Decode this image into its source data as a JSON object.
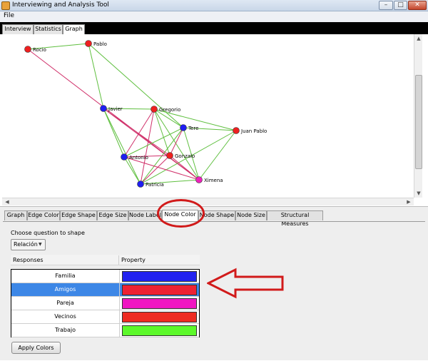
{
  "window": {
    "title": "Interviewing and Analysis Tool",
    "min_glyph": "–",
    "max_glyph": "□",
    "close_glyph": "✕"
  },
  "menu": {
    "file": "File"
  },
  "top_tabs": [
    {
      "label": "Interview",
      "active": false
    },
    {
      "label": "Statistics",
      "active": false
    },
    {
      "label": "Graph",
      "active": true
    }
  ],
  "graph": {
    "colors": {
      "blue": "#1f1ff0",
      "red": "#ee2020",
      "magenta": "#ee22bb",
      "edge_green": "#5fbf3f",
      "edge_pink": "#d0306a"
    },
    "nodes": [
      {
        "id": "rocio",
        "label": "Rocio",
        "color": "red"
      },
      {
        "id": "pablo",
        "label": "Pablo",
        "color": "red"
      },
      {
        "id": "javier",
        "label": "Javier",
        "color": "blue"
      },
      {
        "id": "gregorio",
        "label": "Gregorio",
        "color": "red"
      },
      {
        "id": "tere",
        "label": "Tere",
        "color": "blue"
      },
      {
        "id": "juanpablo",
        "label": "Juan Pablo",
        "color": "red"
      },
      {
        "id": "antonio",
        "label": "Antonio",
        "color": "blue"
      },
      {
        "id": "gonzalo",
        "label": "Gonzalo",
        "color": "red"
      },
      {
        "id": "ximena",
        "label": "Ximena",
        "color": "magenta"
      },
      {
        "id": "patricia",
        "label": "Patricia",
        "color": "blue"
      }
    ],
    "edges": [
      [
        "rocio",
        "pablo",
        "green"
      ],
      [
        "rocio",
        "ximena",
        "pink"
      ],
      [
        "pablo",
        "javier",
        "green"
      ],
      [
        "pablo",
        "tere",
        "green"
      ],
      [
        "javier",
        "gregorio",
        "green"
      ],
      [
        "javier",
        "antonio",
        "green"
      ],
      [
        "javier",
        "patricia",
        "green"
      ],
      [
        "javier",
        "ximena",
        "pink"
      ],
      [
        "javier",
        "gonzalo",
        "pink"
      ],
      [
        "gregorio",
        "juanpablo",
        "green"
      ],
      [
        "gregorio",
        "antonio",
        "pink"
      ],
      [
        "gregorio",
        "patricia",
        "pink"
      ],
      [
        "gregorio",
        "gonzalo",
        "green"
      ],
      [
        "gregorio",
        "ximena",
        "green"
      ],
      [
        "gregorio",
        "tere",
        "green"
      ],
      [
        "tere",
        "juanpablo",
        "green"
      ],
      [
        "tere",
        "antonio",
        "green"
      ],
      [
        "tere",
        "patricia",
        "green"
      ],
      [
        "tere",
        "gonzalo",
        "pink"
      ],
      [
        "tere",
        "ximena",
        "green"
      ],
      [
        "juanpablo",
        "ximena",
        "green"
      ],
      [
        "juanpablo",
        "patricia",
        "green"
      ],
      [
        "antonio",
        "gonzalo",
        "pink"
      ],
      [
        "antonio",
        "patricia",
        "green"
      ],
      [
        "antonio",
        "ximena",
        "pink"
      ],
      [
        "gonzalo",
        "patricia",
        "pink"
      ],
      [
        "gonzalo",
        "ximena",
        "pink"
      ],
      [
        "patricia",
        "ximena",
        "green"
      ]
    ]
  },
  "sub_tabs": [
    {
      "label": "Graph",
      "active": false
    },
    {
      "label": "Edge Color",
      "active": false
    },
    {
      "label": "Edge Shape",
      "active": false
    },
    {
      "label": "Edge Size",
      "active": false
    },
    {
      "label": "Node Label",
      "active": false
    },
    {
      "label": "Node Color",
      "active": true
    },
    {
      "label": "Node Shape",
      "active": false
    },
    {
      "label": "Node Size",
      "active": false
    },
    {
      "label": "Structural Measures",
      "active": false
    }
  ],
  "node_color_panel": {
    "choose_label": "Choose question to shape",
    "selected_question": "Relación",
    "columns": {
      "responses": "Responses",
      "property": "Property"
    },
    "rows": [
      {
        "response": "Familia",
        "color": "#2121f0",
        "selected": false
      },
      {
        "response": "Amigos",
        "color": "#ee2233",
        "selected": true
      },
      {
        "response": "Pareja",
        "color": "#f016c2",
        "selected": false
      },
      {
        "response": "Vecinos",
        "color": "#ee2b22",
        "selected": false
      },
      {
        "response": "Trabajo",
        "color": "#5cf82a",
        "selected": false
      }
    ],
    "apply_label": "Apply Colors"
  },
  "annotation": {
    "color": "#d11a1a"
  }
}
